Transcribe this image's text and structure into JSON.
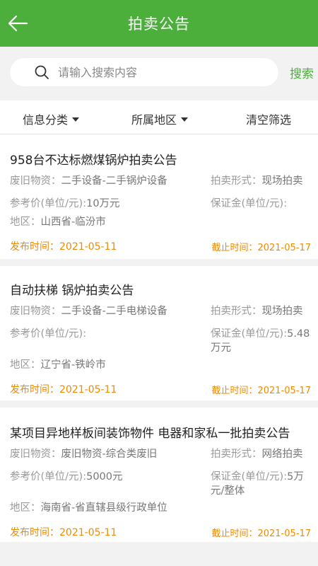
{
  "header": {
    "title": "拍卖公告"
  },
  "search": {
    "placeholder": "请输入搜索内容",
    "button": "搜索"
  },
  "filters": {
    "category": "信息分类",
    "region": "所属地区",
    "clear": "清空筛选"
  },
  "colors": {
    "brand": "#4caf3c",
    "date": "#f08a00"
  },
  "items": [
    {
      "title": "958台不达标燃煤锅炉拍卖公告",
      "material_label": "废旧物资：",
      "material": "二手设备-二手锅炉设备",
      "form_label": "拍卖形式：",
      "form": "现场拍卖",
      "price_label": "参考价(单位/元):",
      "price": "10万元",
      "deposit_label": "保证金(单位/元):",
      "deposit": "",
      "region_label": "地区：",
      "region": "山西省-临汾市",
      "publish": "发布时间：2021-05-11",
      "deadline": "截止时间：2021-05-17"
    },
    {
      "title": "自动扶梯 锅炉拍卖公告",
      "material_label": "废旧物资：",
      "material": "二手设备-二手电梯设备",
      "form_label": "拍卖形式：",
      "form": "现场拍卖",
      "price_label": "参考价(单位/元):",
      "price": "",
      "deposit_label": "保证金(单位/元):",
      "deposit": "5.48万元",
      "region_label": "地区：",
      "region": "辽宁省-铁岭市",
      "publish": "发布时间：2021-05-11",
      "deadline": "截止时间：2021-05-17"
    },
    {
      "title": "某项目异地样板间装饰物件 电器和家私一批拍卖公告",
      "material_label": "废旧物资：",
      "material": "废旧物资-综合类废旧",
      "form_label": "拍卖形式：",
      "form": "网络拍卖",
      "price_label": "参考价(单位/元):",
      "price": "5000元",
      "deposit_label": "保证金(单位/元):",
      "deposit": "5万元/整体",
      "region_label": "地区：",
      "region": "海南省-省直辖县级行政单位",
      "publish": "发布时间：2021-05-11",
      "deadline": "截止时间：2021-05-17"
    }
  ]
}
